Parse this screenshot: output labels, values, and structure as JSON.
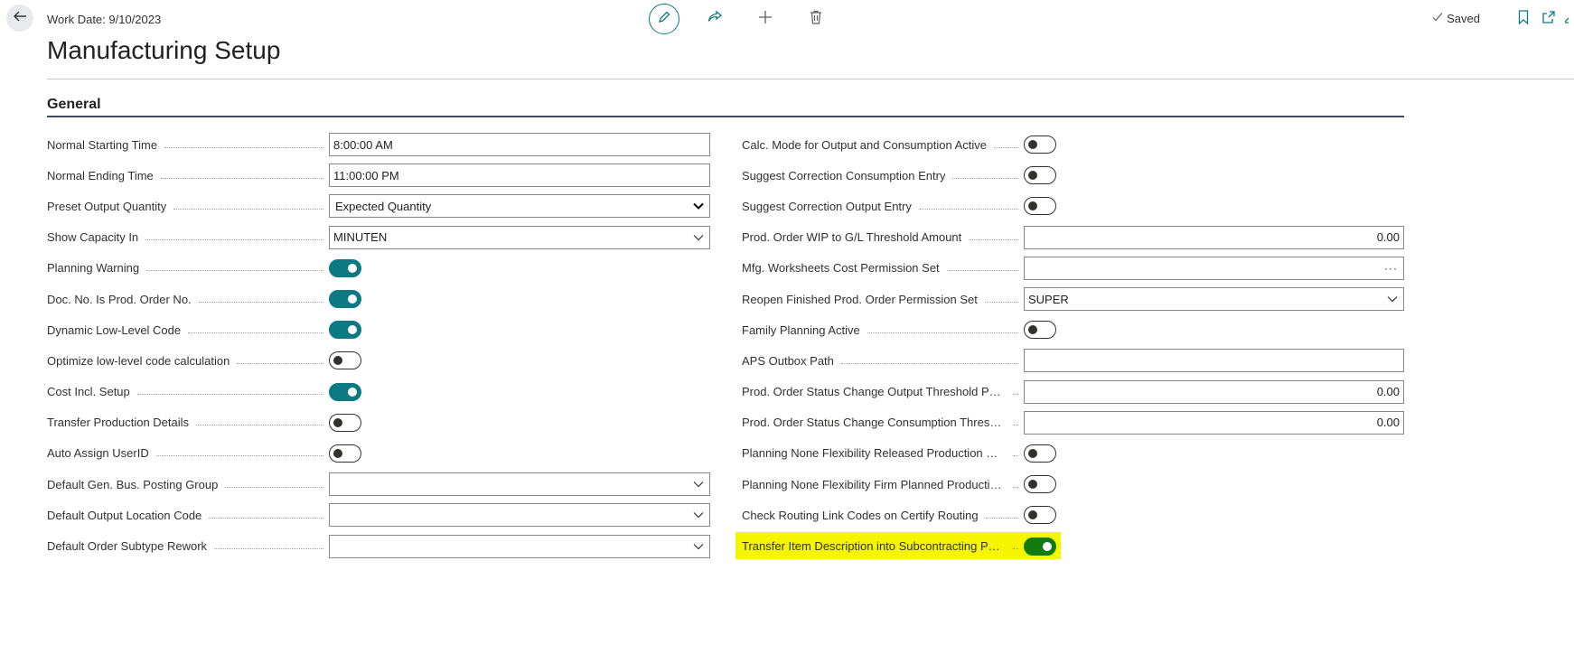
{
  "header": {
    "work_date": "Work Date: 9/10/2023",
    "title": "Manufacturing Setup",
    "saved_label": "Saved",
    "icons": [
      "back-arrow-icon",
      "edit-icon",
      "share-icon",
      "add-icon",
      "delete-icon",
      "check-icon",
      "bookmark-icon",
      "open-new-window-icon"
    ]
  },
  "section": {
    "title": "General"
  },
  "colors": {
    "accent": "#0b7a83",
    "highlight": "#f5f500",
    "toggle_green": "#107c10"
  },
  "left_fields": [
    {
      "label": "Normal Starting Time",
      "type": "text",
      "value": "8:00:00 AM"
    },
    {
      "label": "Normal Ending Time",
      "type": "text",
      "value": "11:00:00 PM"
    },
    {
      "label": "Preset Output Quantity",
      "type": "select-open",
      "value": "Expected Quantity"
    },
    {
      "label": "Show Capacity In",
      "type": "select",
      "value": "MINUTEN"
    },
    {
      "label": "Planning Warning",
      "type": "toggle",
      "value": "on"
    },
    {
      "label": "Doc. No. Is Prod. Order No.",
      "type": "toggle",
      "value": "on"
    },
    {
      "label": "Dynamic Low-Level Code",
      "type": "toggle",
      "value": "on"
    },
    {
      "label": "Optimize low-level code calculation",
      "type": "toggle",
      "value": "off"
    },
    {
      "label": "Cost Incl. Setup",
      "type": "toggle",
      "value": "on"
    },
    {
      "label": "Transfer Production Details",
      "type": "toggle",
      "value": "off"
    },
    {
      "label": "Auto Assign UserID",
      "type": "toggle",
      "value": "off"
    },
    {
      "label": "Default Gen. Bus. Posting Group",
      "type": "select",
      "value": ""
    },
    {
      "label": "Default Output Location Code",
      "type": "select",
      "value": ""
    },
    {
      "label": "Default Order Subtype Rework",
      "type": "select",
      "value": ""
    }
  ],
  "right_fields": [
    {
      "label": "Calc. Mode for Output and Consumption Active",
      "type": "toggle",
      "value": "off"
    },
    {
      "label": "Suggest Correction Consumption Entry",
      "type": "toggle",
      "value": "off"
    },
    {
      "label": "Suggest Correction Output Entry",
      "type": "toggle",
      "value": "off"
    },
    {
      "label": "Prod. Order WIP to G/L Threshold Amount",
      "type": "number",
      "value": "0.00"
    },
    {
      "label": "Mfg. Worksheets Cost Permission Set",
      "type": "lookup",
      "value": ""
    },
    {
      "label": "Reopen Finished Prod. Order Permission Set",
      "type": "select",
      "value": "SUPER"
    },
    {
      "label": "Family Planning Active",
      "type": "toggle",
      "value": "off"
    },
    {
      "label": "APS Outbox Path",
      "type": "text",
      "value": ""
    },
    {
      "label": "Prod. Order Status Change Output Threshold Perce...",
      "type": "number",
      "value": "0.00"
    },
    {
      "label": "Prod. Order Status Change Consumption Threshol...",
      "type": "number",
      "value": "0.00"
    },
    {
      "label": "Planning None Flexibility Released Production Order",
      "type": "toggle",
      "value": "off"
    },
    {
      "label": "Planning None Flexibility Firm Planned Production ...",
      "type": "toggle",
      "value": "off"
    },
    {
      "label": "Check Routing Link Codes on Certify Routing",
      "type": "toggle",
      "value": "off"
    },
    {
      "label": "Transfer Item Description into Subcontracting Purc...",
      "type": "toggle",
      "value": "on",
      "highlighted": true
    }
  ]
}
